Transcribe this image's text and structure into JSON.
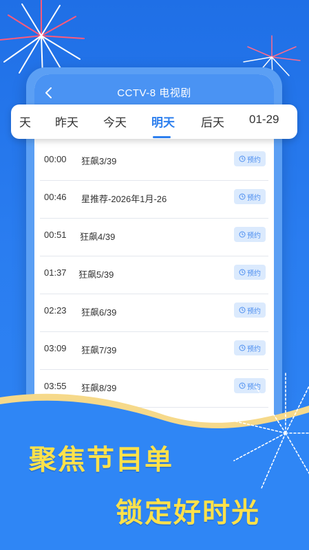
{
  "header": {
    "title": "CCTV-8 电视剧"
  },
  "tabs": [
    {
      "label": "天"
    },
    {
      "label": "昨天"
    },
    {
      "label": "今天"
    },
    {
      "label": "明天",
      "active": true
    },
    {
      "label": "后天"
    },
    {
      "label": "01-29"
    }
  ],
  "programs": [
    {
      "time": "00:00",
      "title": "狂飙3/39",
      "action": "预约"
    },
    {
      "time": "00:46",
      "title": "星推荐-2026年1月-26",
      "action": "预约"
    },
    {
      "time": "00:51",
      "title": "狂飙4/39",
      "action": "预约"
    },
    {
      "time": "01:37",
      "title": "狂飙5/39",
      "action": "预约"
    },
    {
      "time": "02:23",
      "title": "狂飙6/39",
      "action": "预约"
    },
    {
      "time": "03:09",
      "title": "狂飙7/39",
      "action": "预约"
    },
    {
      "time": "03:55",
      "title": "狂飙8/39",
      "action": "预约"
    }
  ],
  "slogan": {
    "line1": "聚焦节目单",
    "line2": "锁定好时光"
  },
  "colors": {
    "accent": "#2d7fee",
    "header": "#4a93f3",
    "slogan": "#ffe14a",
    "background": "#2a7df0"
  }
}
